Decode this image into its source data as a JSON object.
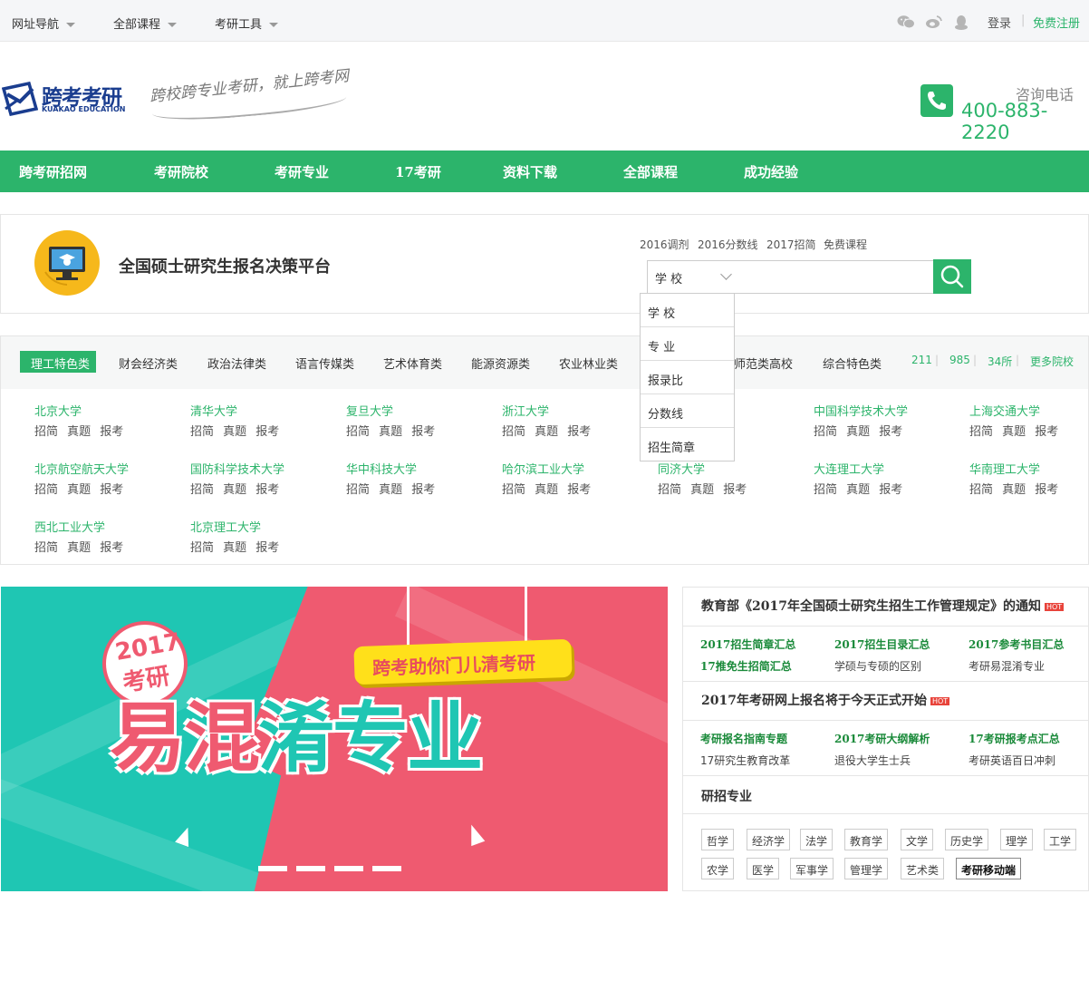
{
  "topbar": {
    "nav": [
      "网址导航",
      "全部课程",
      "考研工具"
    ],
    "social_icons": [
      "wechat-icon",
      "weibo-icon",
      "qq-icon"
    ],
    "login": "登录",
    "separator": "|",
    "register": "免费注册"
  },
  "header": {
    "logo_name": "跨考考研",
    "logo_en": "KUAKAO EDUCATION",
    "slogan": "跨校跨专业考研，就上跨考网",
    "phone_label": "咨询电话",
    "phone_number": "400-883-2220"
  },
  "mainnav": [
    "跨考研招网",
    "考研院校",
    "考研专业",
    "17考研",
    "资料下载",
    "全部课程",
    "成功经验"
  ],
  "platform": {
    "title": "全国硕士研究生报名决策平台",
    "quick_links": [
      "2016调剂",
      "2016分数线",
      "2017招简",
      "免费课程"
    ],
    "select_value": "学 校",
    "search_placeholder": "",
    "dropdown": [
      "学 校",
      "专 业",
      "报录比",
      "分数线",
      "招生简章"
    ]
  },
  "categories": {
    "tabs": [
      "理工特色类",
      "财会经济类",
      "政治法律类",
      "语言传媒类",
      "艺术体育类",
      "能源资源类",
      "农业林业类",
      "师范类高校",
      "综合特色类"
    ],
    "right_links": [
      "211",
      "985",
      "34所",
      "更多院校"
    ],
    "universities": [
      "北京大学",
      "清华大学",
      "复旦大学",
      "浙江大学",
      "",
      "中国科学技术大学",
      "上海交通大学",
      "北京航空航天大学",
      "国防科学技术大学",
      "华中科技大学",
      "哈尔滨工业大学",
      "同济大学",
      "大连理工大学",
      "华南理工大学",
      "西北工业大学",
      "北京理工大学"
    ],
    "uni_links": "招简 真题 报考"
  },
  "banner": {
    "year": "2017",
    "ky": "考研",
    "tag": "跨考助你门儿清考研",
    "main": [
      "易",
      "混",
      "淆",
      "专",
      "业"
    ]
  },
  "news": {
    "headline1": "教育部《2017年全国硕士研究生招生工作管理规定》的通知",
    "hot": "HOT",
    "row1": [
      "2017招生简章汇总",
      "2017招生目录汇总",
      "2017参考书目汇总"
    ],
    "row2_bold": "17推免生招简汇总",
    "row2": [
      "学硕与专硕的区别",
      "考研易混淆专业"
    ],
    "headline2": "2017年考研网上报名将于今天正式开始",
    "row3": [
      "考研报名指南专题",
      "2017考研大纲解析",
      "17考研报考点汇总"
    ],
    "row4": [
      "17研究生教育改革",
      "退役大学生士兵",
      "考研英语百日冲刺"
    ],
    "section_title": "研招专业",
    "tags_row1": [
      "哲学",
      "经济学",
      "法学",
      "教育学",
      "文学",
      "历史学",
      "理学",
      "工学"
    ],
    "tags_row2": [
      "农学",
      "医学",
      "军事学",
      "管理学",
      "艺术类",
      "考研移动端"
    ]
  },
  "colors": {
    "accent": "#2cb46b",
    "brand_blue": "#1a3d8f",
    "banner_red": "#ef5a70",
    "banner_teal": "#1fc6b3"
  }
}
